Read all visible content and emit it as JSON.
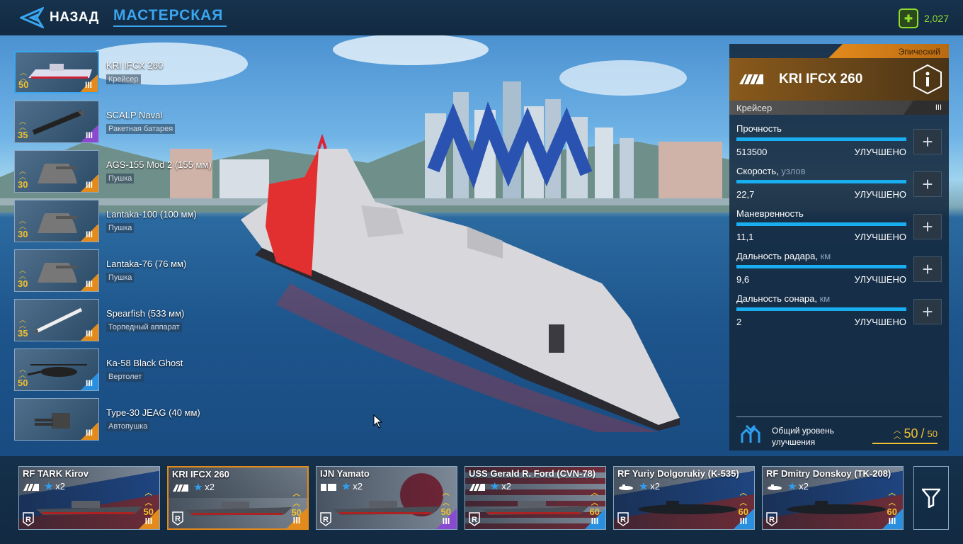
{
  "topbar": {
    "back_label": "НАЗАД",
    "title": "МАСТЕРСКАЯ",
    "currency_value": "2,027",
    "currency_icon": "gift-coupon-icon"
  },
  "modules": [
    {
      "name": "KRI IFCX 260",
      "type": "Крейсер",
      "level": "50",
      "rank": "III",
      "rarity": "orange",
      "icon": "cruiser-hull-icon"
    },
    {
      "name": "SCALP Naval",
      "type": "Ракетная батарея",
      "level": "35",
      "rank": "III",
      "rarity": "purple",
      "icon": "missile-icon"
    },
    {
      "name": "AGS-155 Mod 2 (155 мм)",
      "type": "Пушка",
      "level": "30",
      "rank": "III",
      "rarity": "orange",
      "icon": "turret-icon"
    },
    {
      "name": "Lantaka-100 (100 мм)",
      "type": "Пушка",
      "level": "30",
      "rank": "III",
      "rarity": "orange",
      "icon": "turret-icon"
    },
    {
      "name": "Lantaka-76 (76 мм)",
      "type": "Пушка",
      "level": "30",
      "rank": "III",
      "rarity": "orange",
      "icon": "turret-icon"
    },
    {
      "name": "Spearfish (533 мм)",
      "type": "Торпедный аппарат",
      "level": "35",
      "rank": "III",
      "rarity": "orange",
      "icon": "torpedo-icon"
    },
    {
      "name": "Ka-58 Black Ghost",
      "type": "Вертолет",
      "level": "50",
      "rank": "III",
      "rarity": "blue",
      "icon": "helicopter-icon"
    },
    {
      "name": "Type-30 JEAG (40 мм)",
      "type": "Автопушка",
      "level": "",
      "rank": "III",
      "rarity": "orange",
      "icon": "autocannon-icon"
    }
  ],
  "panel": {
    "rarity": "Эпический",
    "ship_name": "KRI IFCX 260",
    "class": "Крейсер",
    "class_rank": "III",
    "stats": [
      {
        "label": "Прочность",
        "unit": "",
        "value": "513500",
        "status": "УЛУЧШЕНО",
        "fill": 1.0
      },
      {
        "label": "Скорость,",
        "unit": " узлов",
        "value": "22,7",
        "status": "УЛУЧШЕНО",
        "fill": 1.0
      },
      {
        "label": "Маневренность",
        "unit": "",
        "value": "11,1",
        "status": "УЛУЧШЕНО",
        "fill": 1.0
      },
      {
        "label": "Дальность радара,",
        "unit": " км",
        "value": "9,6",
        "status": "УЛУЧШЕНО",
        "fill": 1.0
      },
      {
        "label": "Дальность сонара,",
        "unit": " км",
        "value": "2",
        "status": "УЛУЧШЕНО",
        "fill": 1.0
      }
    ],
    "overall_label_1": "Общий уровень",
    "overall_label_2": "улучшения",
    "overall_value": "50",
    "overall_sep": "/",
    "overall_max": "50"
  },
  "fleet": [
    {
      "name": "RF TARK Kirov",
      "multiplier": "x2",
      "level": "50",
      "rank": "III",
      "rarity": "orange",
      "flag": "russia",
      "class_icon": "cruiser-class-icon"
    },
    {
      "name": "KRI IFCX 260",
      "multiplier": "x2",
      "level": "50",
      "rank": "III",
      "rarity": "orange",
      "flag": "indonesia",
      "class_icon": "cruiser-class-icon"
    },
    {
      "name": "IJN Yamato",
      "multiplier": "x2",
      "level": "50",
      "rank": "III",
      "rarity": "purple",
      "flag": "japan",
      "class_icon": "battleship-class-icon"
    },
    {
      "name": "USS Gerald R. Ford (CVN-78)",
      "multiplier": "x2",
      "level": "60",
      "rank": "III",
      "rarity": "blue",
      "flag": "usa",
      "class_icon": "cruiser-class-icon"
    },
    {
      "name": "RF Yuriy Dolgorukiy (K-535)",
      "multiplier": "x2",
      "level": "60",
      "rank": "III",
      "rarity": "blue",
      "flag": "russia",
      "class_icon": "submarine-class-icon"
    },
    {
      "name": "RF Dmitry Donskoy (TK-208)",
      "multiplier": "x2",
      "level": "60",
      "rank": "III",
      "rarity": "blue",
      "flag": "russia",
      "class_icon": "submarine-class-icon"
    }
  ],
  "colors": {
    "accent": "#3aa6f0",
    "epic": "#e38a1c",
    "gold": "#f0c030",
    "currency": "#8fdc2e",
    "stat_bar": "#18aef0"
  }
}
